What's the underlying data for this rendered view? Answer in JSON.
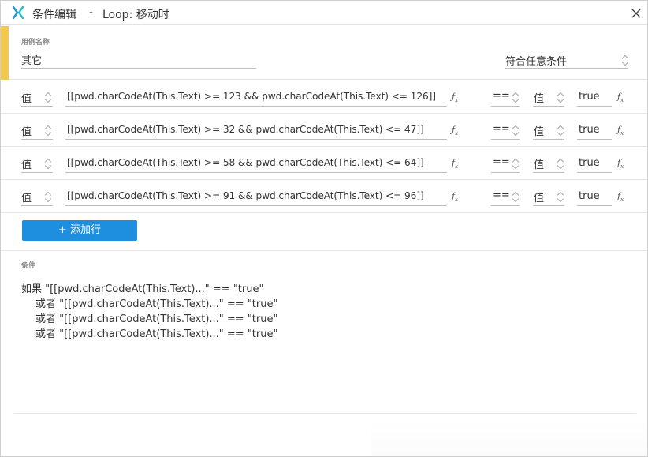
{
  "titlebar": {
    "title": "条件编辑",
    "separator": "-",
    "subtitle": "Loop: 移动时",
    "logo_icon": "axure-x-logo",
    "close_icon": "close-icon",
    "accent": "#1e8ede"
  },
  "case": {
    "label": "用例名称",
    "name_value": "其它",
    "match_mode": "符合任意条件",
    "accent_bar": "#f2c94c"
  },
  "rows": [
    {
      "left_type": "值",
      "expression": "[[pwd.charCodeAt(This.Text) >= 123 && pwd.charCodeAt(This.Text) <= 126]]",
      "operator": "==",
      "right_type": "值",
      "value": "true"
    },
    {
      "left_type": "值",
      "expression": "[[pwd.charCodeAt(This.Text) >= 32 && pwd.charCodeAt(This.Text) <= 47]]",
      "operator": "==",
      "right_type": "值",
      "value": "true"
    },
    {
      "left_type": "值",
      "expression": "[[pwd.charCodeAt(This.Text) >= 58 && pwd.charCodeAt(This.Text) <= 64]]",
      "operator": "==",
      "right_type": "值",
      "value": "true"
    },
    {
      "left_type": "值",
      "expression": "[[pwd.charCodeAt(This.Text) >= 91 && pwd.charCodeAt(This.Text) <= 96]]",
      "operator": "==",
      "right_type": "值",
      "value": "true"
    }
  ],
  "fx_label": "fx",
  "add_row_label": "+ 添加行",
  "summary": {
    "label": "条件",
    "lines": [
      "如果 \"[[pwd.charCodeAt(This.Text)...\" == \"true\"",
      "或者 \"[[pwd.charCodeAt(This.Text)...\" == \"true\"",
      "或者 \"[[pwd.charCodeAt(This.Text)...\" == \"true\"",
      "或者 \"[[pwd.charCodeAt(This.Text)...\" == \"true\""
    ]
  }
}
